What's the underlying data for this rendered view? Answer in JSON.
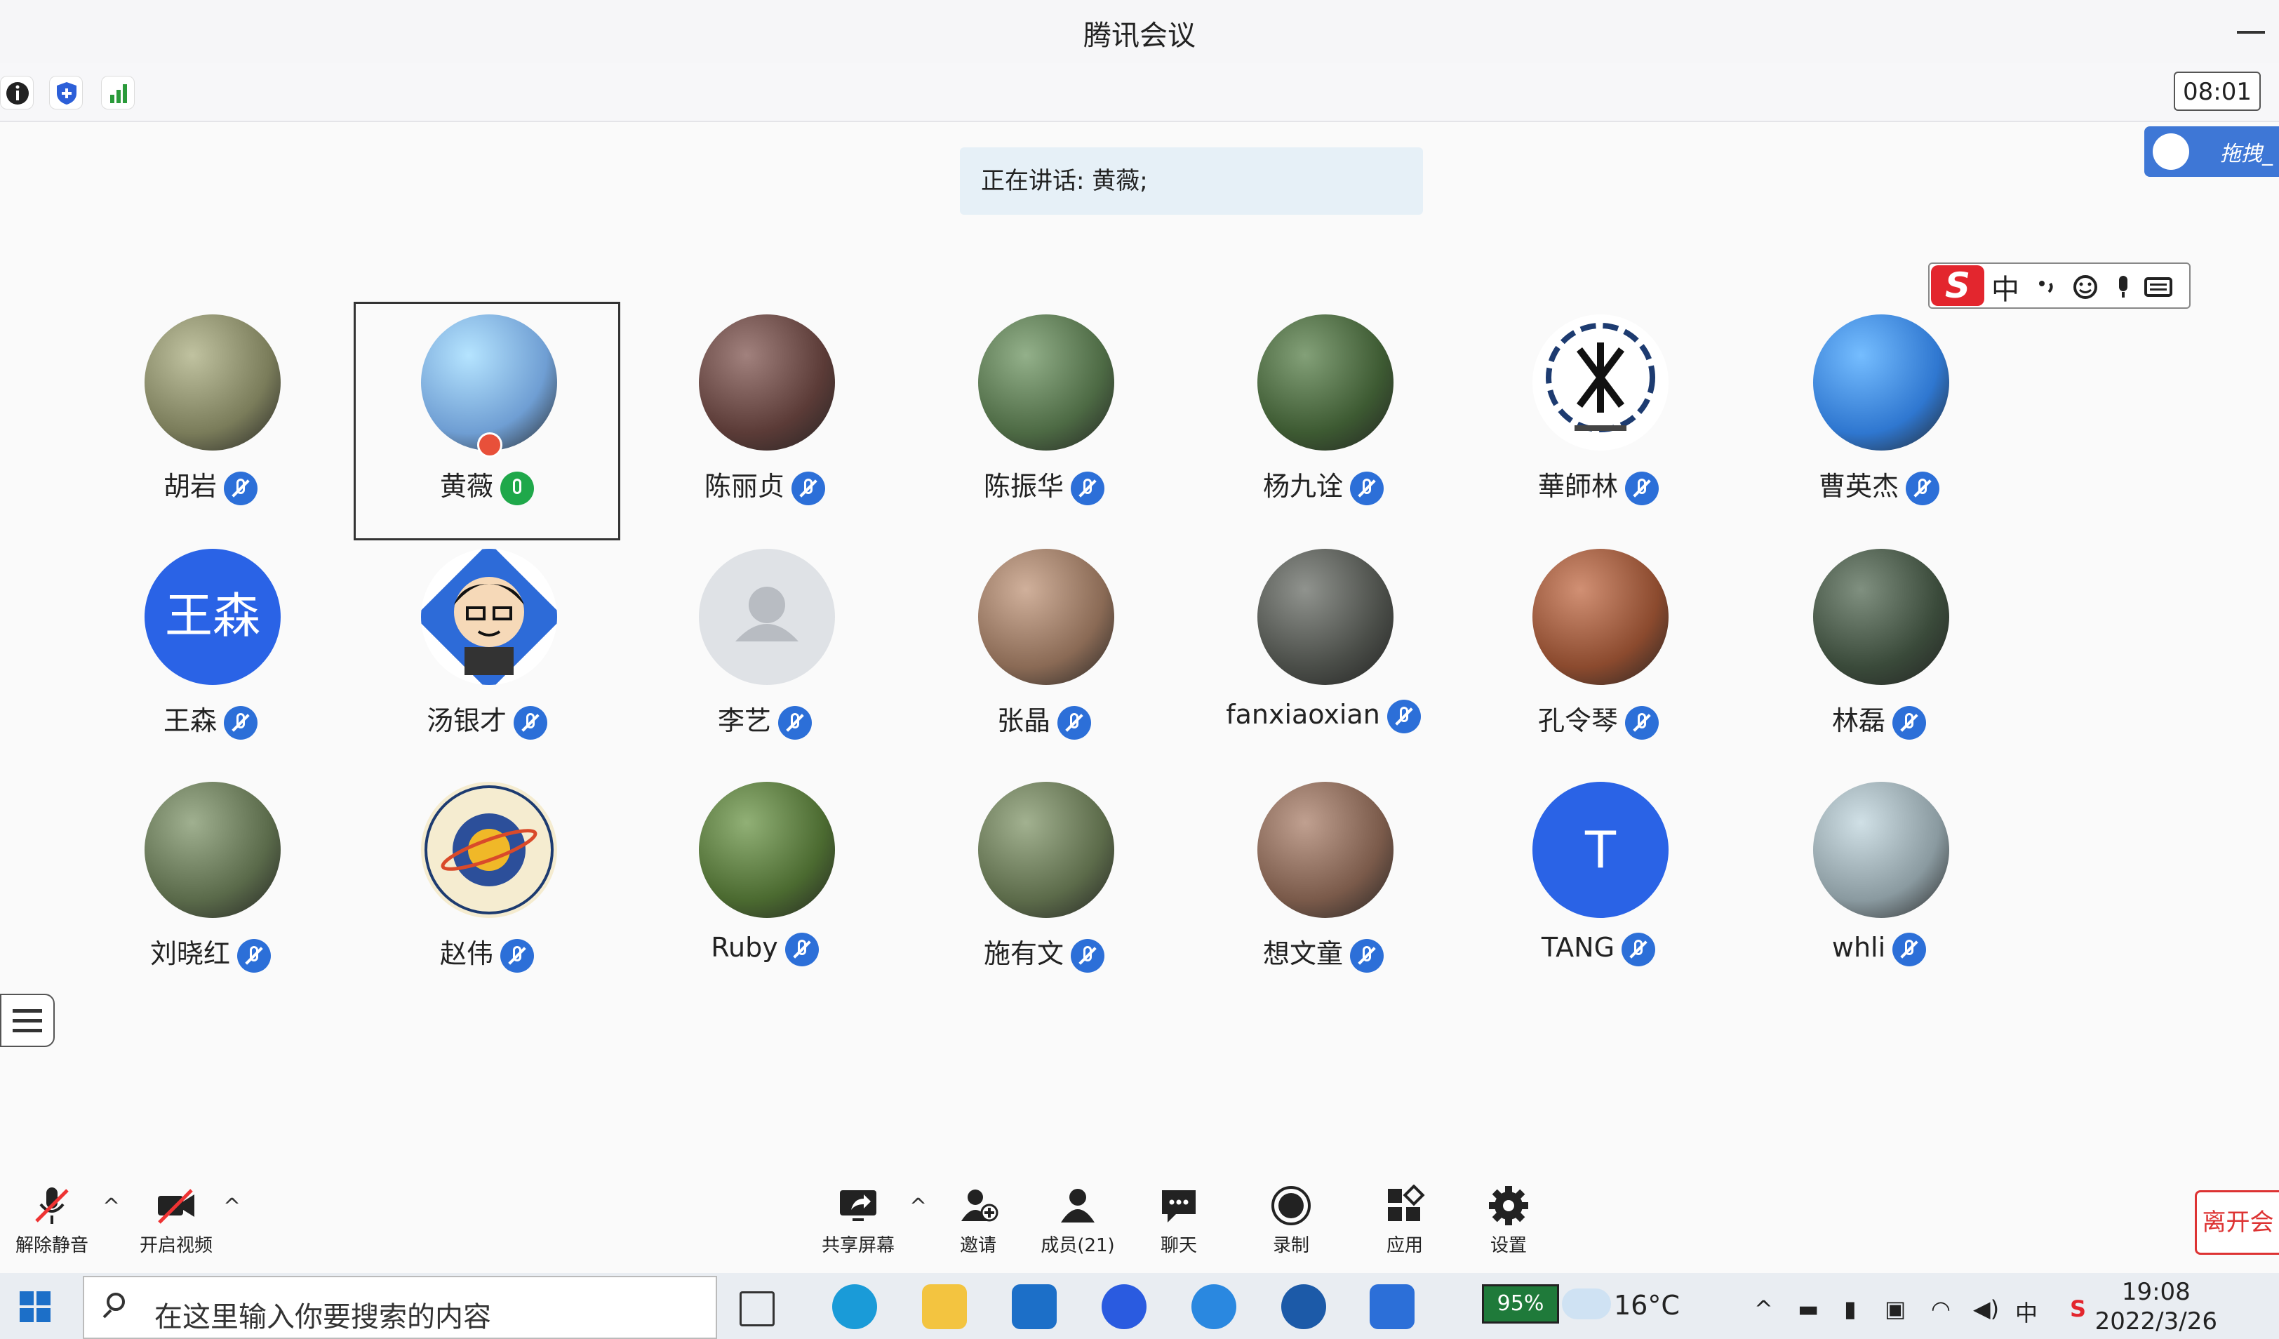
{
  "window": {
    "title": "腾讯会议"
  },
  "toolbar": {
    "timer": "08:01"
  },
  "speaking": {
    "text": "正在讲话: 黄薇;"
  },
  "weblink": {
    "label": "拖拽_"
  },
  "ime": {
    "logo": "S",
    "mode": "中"
  },
  "participants": [
    {
      "name": "胡岩",
      "mic": "muted",
      "avatar": "photo",
      "color": "#7a7c5a"
    },
    {
      "name": "黄薇",
      "mic": "on",
      "avatar": "photo",
      "color": "#6f9ed3",
      "active": true,
      "host": true
    },
    {
      "name": "陈丽贞",
      "mic": "muted",
      "avatar": "photo",
      "color": "#5b3b37"
    },
    {
      "name": "陈振华",
      "mic": "muted",
      "avatar": "photo",
      "color": "#4d6a44"
    },
    {
      "name": "杨九诠",
      "mic": "muted",
      "avatar": "photo",
      "color": "#3d5a32"
    },
    {
      "name": "華師林",
      "mic": "muted",
      "avatar": "logo",
      "color": "#1d3b70"
    },
    {
      "name": "曹英杰",
      "mic": "muted",
      "avatar": "photo",
      "color": "#2f77d0"
    },
    {
      "name": "王森",
      "mic": "muted",
      "avatar": "text",
      "text": "王森",
      "color": "#2a63e6"
    },
    {
      "name": "汤银才",
      "mic": "muted",
      "avatar": "cartoon",
      "color": "#2d6bd8"
    },
    {
      "name": "李艺",
      "mic": "muted",
      "avatar": "default",
      "color": "#dfe2e6"
    },
    {
      "name": "张晶",
      "mic": "muted",
      "avatar": "photo",
      "color": "#8a6a55"
    },
    {
      "name": "fanxiaoxian",
      "mic": "muted",
      "avatar": "photo",
      "color": "#4a4d48"
    },
    {
      "name": "孔令琴",
      "mic": "muted",
      "avatar": "photo",
      "color": "#8b4a2e"
    },
    {
      "name": "林磊",
      "mic": "muted",
      "avatar": "photo",
      "color": "#3a4a3a"
    },
    {
      "name": "刘晓红",
      "mic": "muted",
      "avatar": "photo",
      "color": "#5a6a4a"
    },
    {
      "name": "赵伟",
      "mic": "muted",
      "avatar": "emblem",
      "color": "#e8d9a8"
    },
    {
      "name": "Ruby",
      "mic": "muted",
      "avatar": "photo",
      "color": "#4b6a30"
    },
    {
      "name": "施有文",
      "mic": "muted",
      "avatar": "photo",
      "color": "#5c6b4a"
    },
    {
      "name": "想文童",
      "mic": "muted",
      "avatar": "photo",
      "color": "#7a5a4a"
    },
    {
      "name": "TANG",
      "mic": "muted",
      "avatar": "letter",
      "text": "T",
      "color": "#2a63e6"
    },
    {
      "name": "whli",
      "mic": "muted",
      "avatar": "photo",
      "color": "#8a9aa0"
    }
  ],
  "bottombar": {
    "unmute": "解除静音",
    "video": "开启视频",
    "share": "共享屏幕",
    "invite": "邀请",
    "members": "成员(21)",
    "chat": "聊天",
    "record": "录制",
    "apps": "应用",
    "settings": "设置",
    "leave": "离开会"
  },
  "taskbar": {
    "search_placeholder": "在这里输入你要搜索的内容",
    "battery": "95%",
    "weather": "16°C",
    "ime": "中",
    "time": "19:08",
    "date": "2022/3/26"
  },
  "colors": {
    "accent": "#2c6fd8",
    "mic_on": "#1fa84a",
    "leave": "#d33333"
  }
}
